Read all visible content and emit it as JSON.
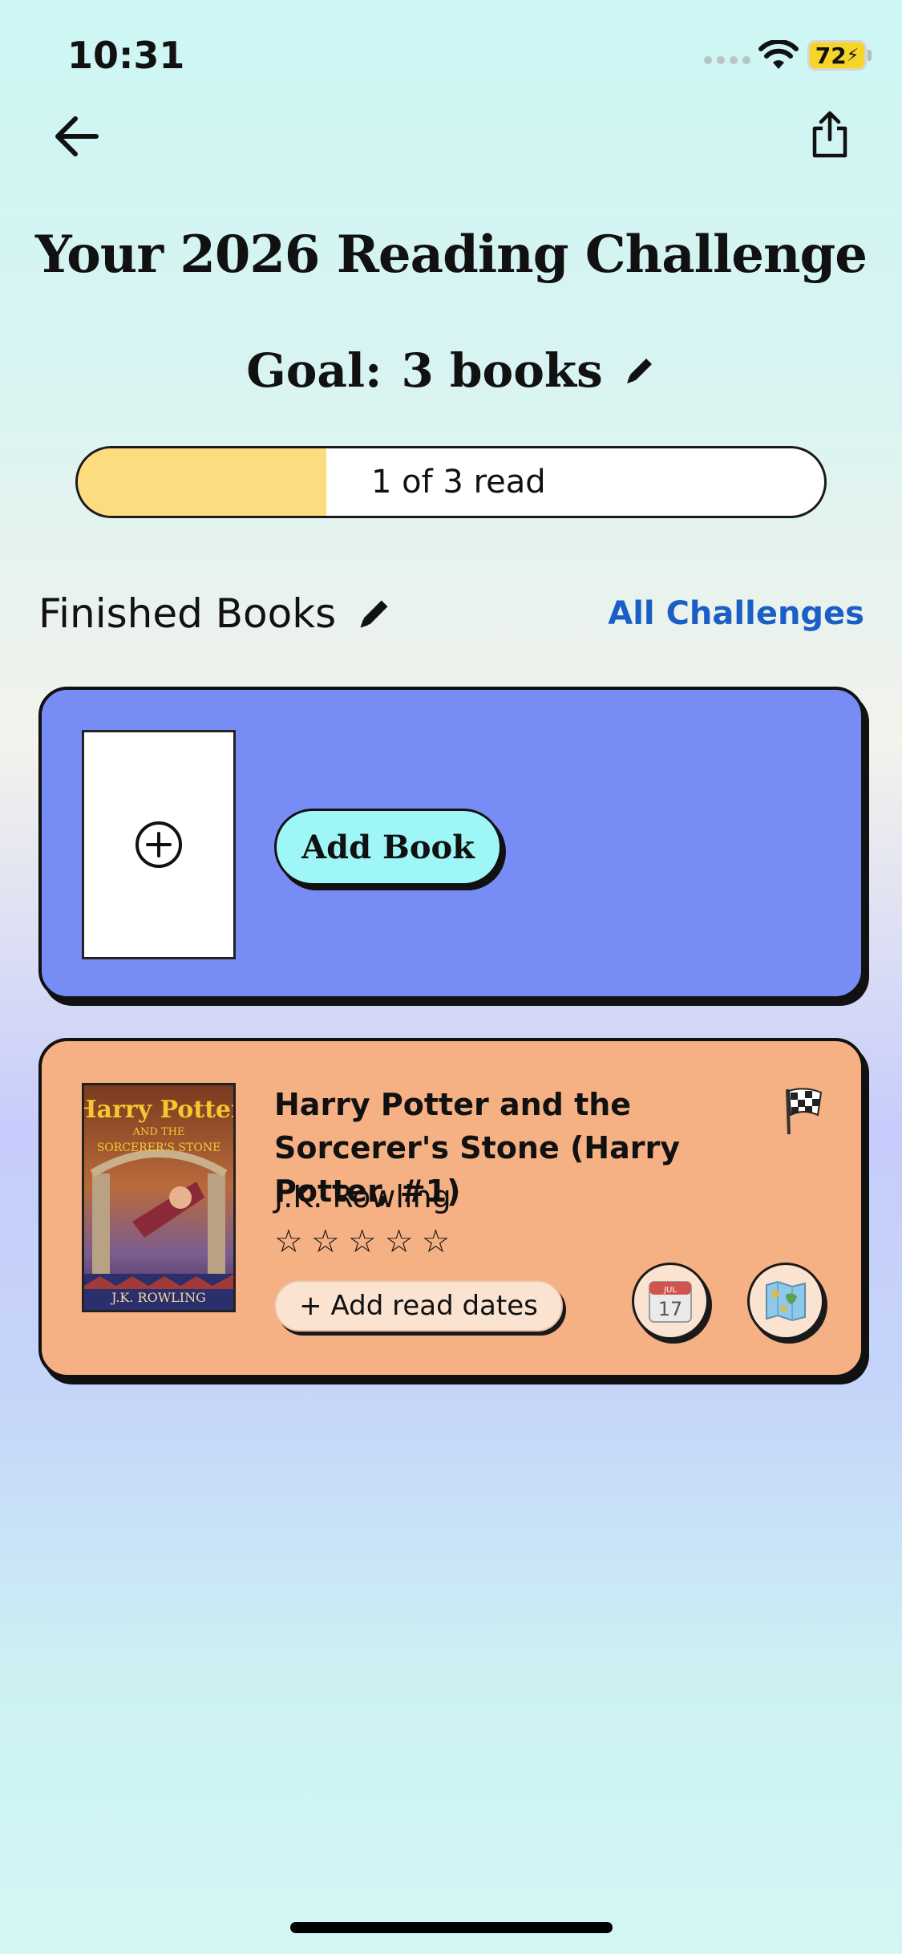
{
  "status_bar": {
    "time": "10:31",
    "battery": "72"
  },
  "nav": {
    "back_icon": "arrow-left-icon",
    "share_icon": "share-icon"
  },
  "header": {
    "title": "Your 2026 Reading Challenge",
    "goal_label": "Goal:",
    "goal_value": "3 books"
  },
  "progress": {
    "label": "1 of 3 read",
    "read": 1,
    "goal": 3,
    "fill_color": "#fddc80"
  },
  "section": {
    "title": "Finished Books",
    "link": "All Challenges",
    "link_color": "#1b5fc6"
  },
  "add_card": {
    "button_label": "Add Book",
    "background": "#788cf5",
    "icon": "plus-circle-icon"
  },
  "book": {
    "title": "Harry Potter and the Sorcerer's Stone (Harry Potter, #1)",
    "author": "J.K. Rowling",
    "rating": 0,
    "rating_max": 5,
    "read_dates_button": "+ Add read dates",
    "calendar_month": "JUL",
    "calendar_day": "17",
    "cover": {
      "title_line1": "Harry Potter",
      "title_line2": "AND THE",
      "title_line3": "SORCERER'S STONE",
      "author": "J.K. ROWLING"
    },
    "background": "#f5b084"
  }
}
